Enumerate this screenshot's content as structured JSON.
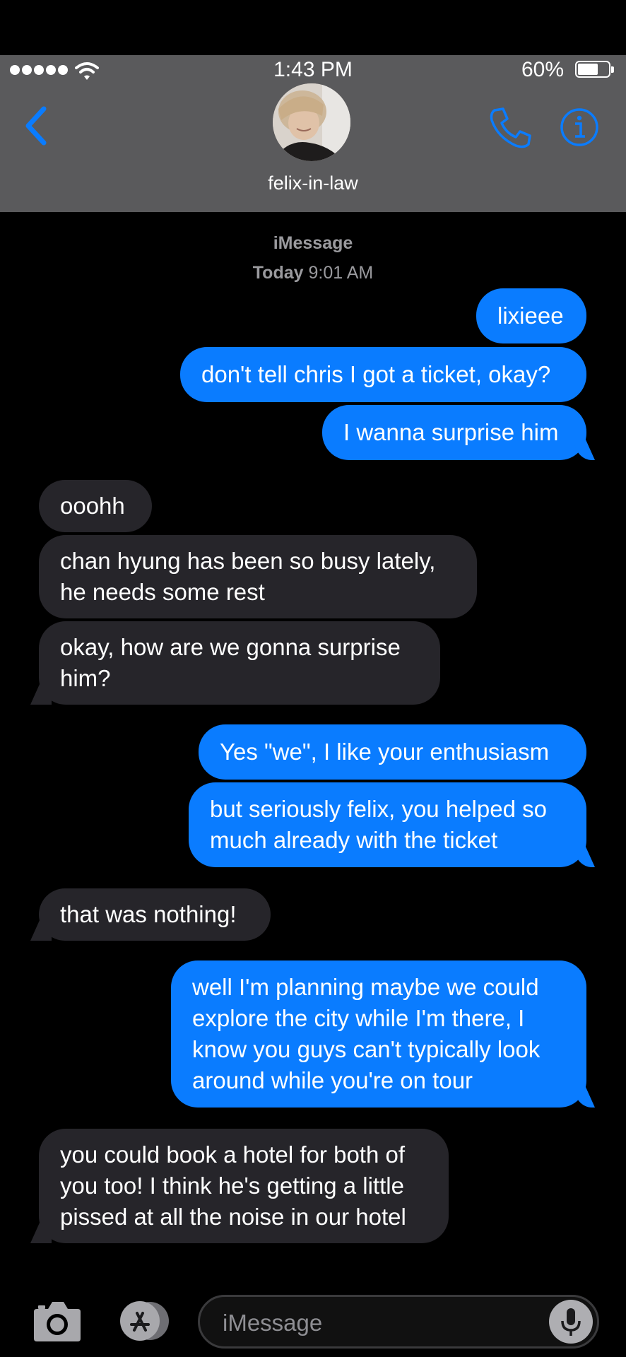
{
  "status_bar": {
    "time": "1:43 PM",
    "battery_percent": "60%",
    "signal_icon": "signal-dots-icon",
    "wifi_icon": "wifi-icon",
    "battery_level": 0.6
  },
  "header": {
    "contact_name": "felix-in-law",
    "back_icon": "chevron-left-icon",
    "call_icon": "phone-icon",
    "info_icon": "info-icon",
    "accent_color": "#0a7cff"
  },
  "thread": {
    "service_label": "iMessage",
    "timestamp_day": "Today",
    "timestamp_time": "9:01 AM",
    "messages": [
      {
        "direction": "sent",
        "lines": [
          "lixieee"
        ]
      },
      {
        "direction": "sent",
        "lines": [
          "don't tell chris I got a ticket, okay?"
        ]
      },
      {
        "direction": "sent",
        "lines": [
          "I wanna surprise him"
        ]
      },
      {
        "direction": "received",
        "lines": [
          "ooohh"
        ]
      },
      {
        "direction": "received",
        "lines": [
          "chan hyung has been so busy lately,",
          "he needs some rest"
        ]
      },
      {
        "direction": "received",
        "lines": [
          "okay, how are we gonna surprise",
          "him?"
        ]
      },
      {
        "direction": "sent",
        "lines": [
          "Yes \"we\", I like your enthusiasm"
        ]
      },
      {
        "direction": "sent",
        "lines": [
          "but seriously felix, you helped so",
          "much already with the ticket"
        ]
      },
      {
        "direction": "received",
        "lines": [
          "that was nothing!"
        ]
      },
      {
        "direction": "sent",
        "lines": [
          "well I'm planning maybe we could",
          "explore the city while I'm there, I",
          "know you guys can't typically look",
          "around while you're on tour"
        ]
      },
      {
        "direction": "received",
        "lines": [
          "you could book a hotel for both of",
          "you too! I think he's getting a little",
          "pissed at all the noise in our hotel"
        ]
      }
    ],
    "sent_color": "#0a7cff",
    "received_color": "#26252a"
  },
  "composer": {
    "placeholder": "iMessage",
    "camera_icon": "camera-icon",
    "apps_icon": "app-store-icon",
    "mic_icon": "microphone-icon"
  }
}
